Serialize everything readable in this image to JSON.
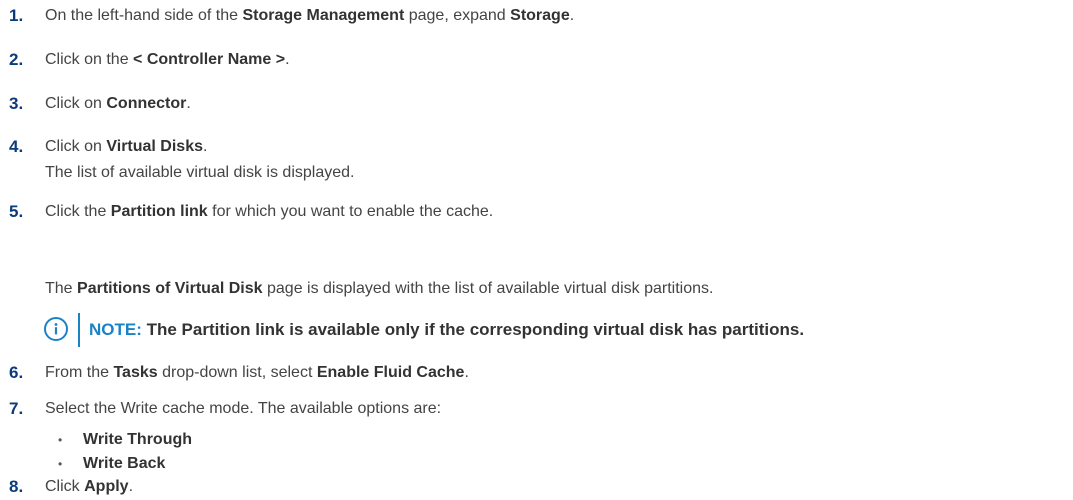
{
  "steps": [
    {
      "num": "1.",
      "pre": "On the left-hand side of the ",
      "b1": "Storage Management",
      "mid": " page, expand ",
      "b2": "Storage",
      "post": "."
    },
    {
      "num": "2.",
      "pre": "Click on the ",
      "b1": "< Controller Name >",
      "post": "."
    },
    {
      "num": "3.",
      "pre": "Click on ",
      "b1": "Connector",
      "post": "."
    },
    {
      "num": "4.",
      "pre": "Click on ",
      "b1": "Virtual Disks",
      "post": ".",
      "sub": "The list of available virtual disk is displayed."
    },
    {
      "num": "5.",
      "pre": "Click the ",
      "b1": "Partition link",
      "post": " for which you want to enable the cache.",
      "sub_pre": "The ",
      "sub_b": "Partitions of Virtual Disk",
      "sub_post": " page is displayed with the list of available virtual disk partitions."
    },
    {
      "num": "6.",
      "pre": "From the ",
      "b1": "Tasks",
      "mid": " drop-down list, select ",
      "b2": "Enable Fluid Cache",
      "post": "."
    },
    {
      "num": "7.",
      "pre": "Select the Write cache mode. The available options are:"
    },
    {
      "num": "8.",
      "pre": "Click ",
      "b1": "Apply",
      "post": "."
    }
  ],
  "note": {
    "label": "NOTE:",
    "text": " The Partition link is available only if the corresponding virtual disk has partitions.",
    "icon": "info-icon",
    "accent": "#1a83c7"
  },
  "options": [
    {
      "bullet": "•",
      "label": "Write Through"
    },
    {
      "bullet": "•",
      "label": "Write Back"
    }
  ],
  "colors": {
    "step_number": "#0b3b7a",
    "body_text": "#444444",
    "accent": "#1a83c7"
  }
}
